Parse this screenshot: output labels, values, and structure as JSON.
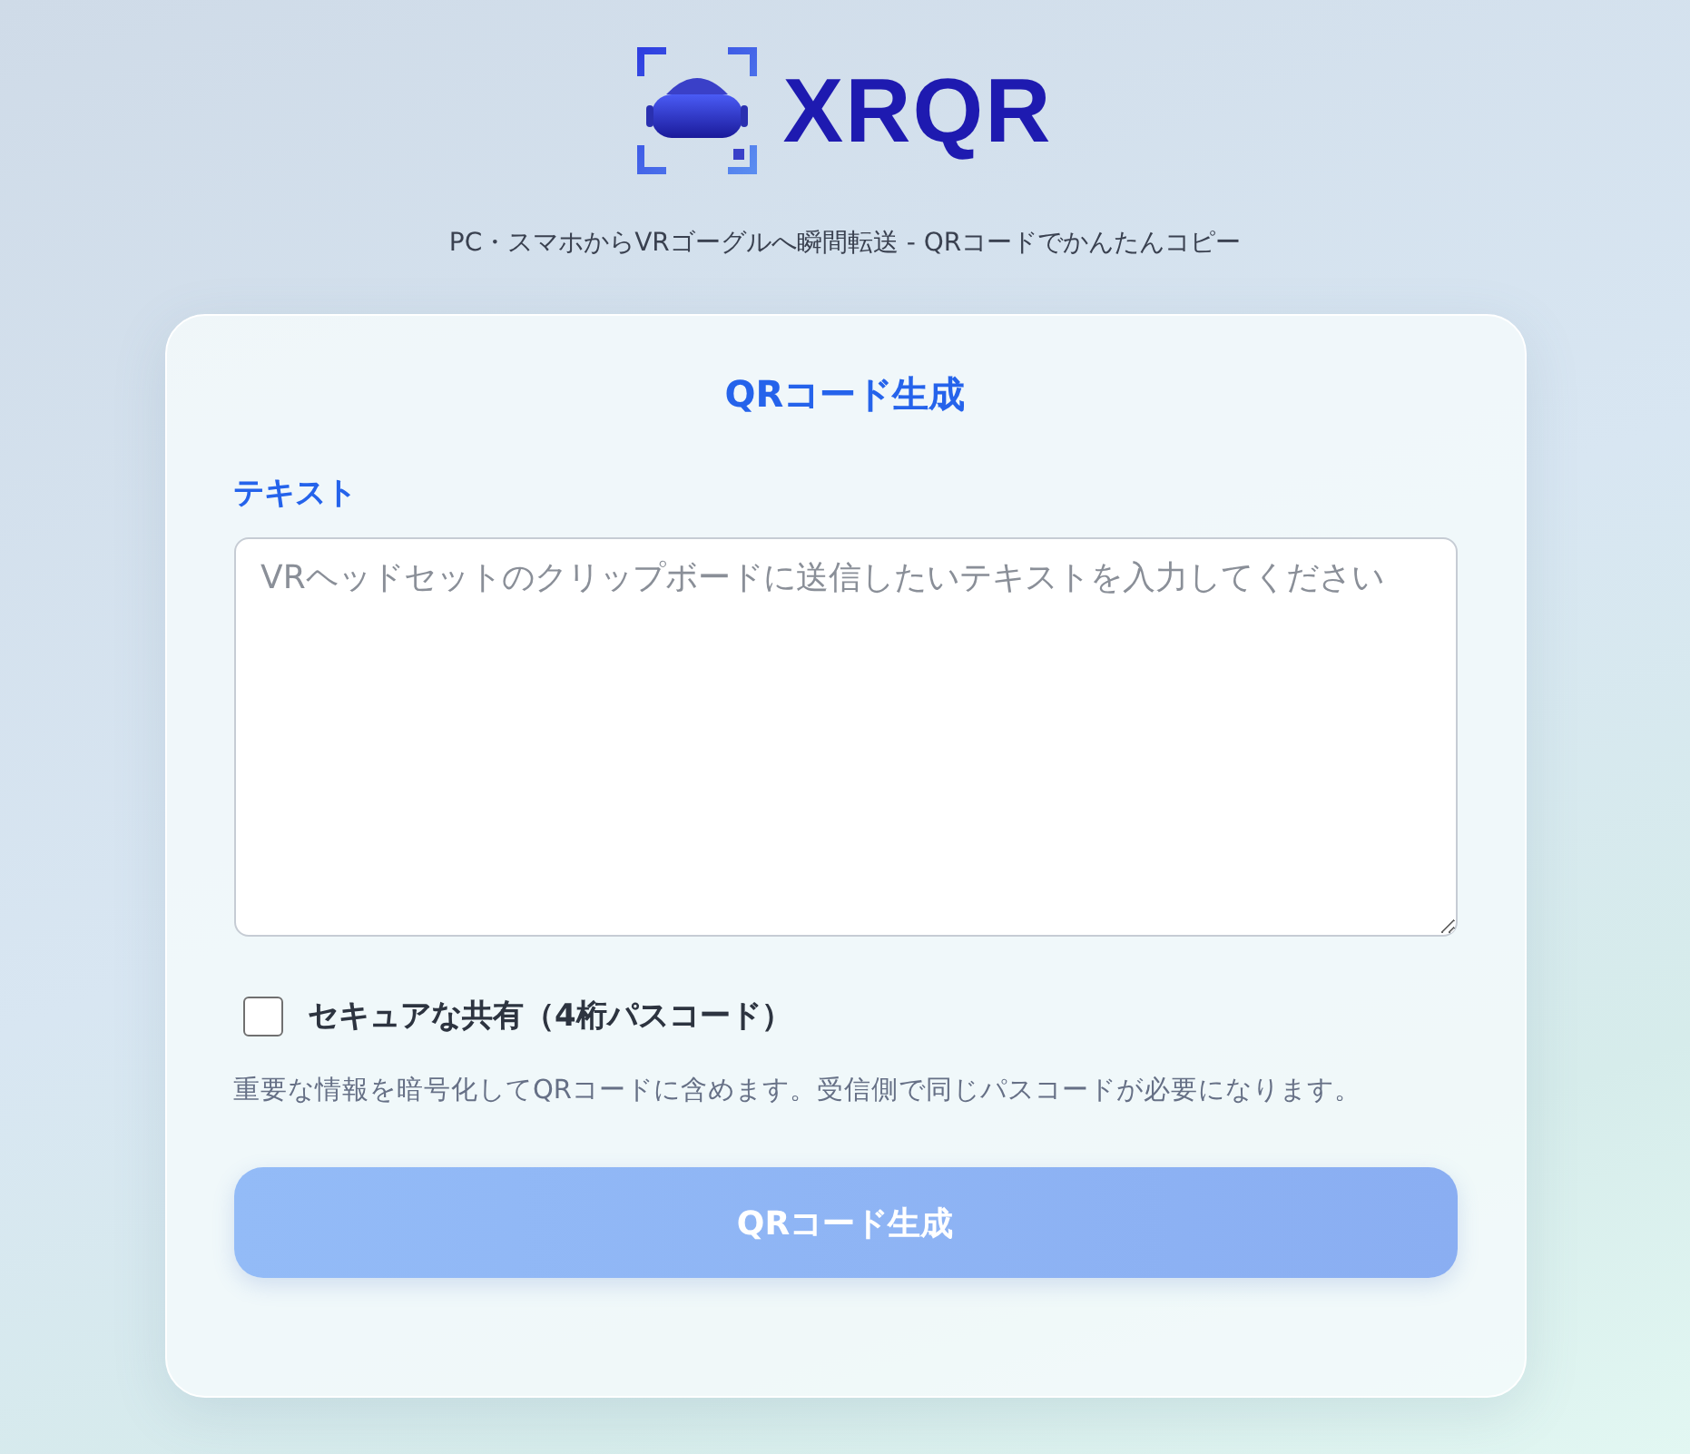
{
  "header": {
    "logo_text": "XRQR",
    "tagline": "PC・スマホからVRゴーグルへ瞬間転送 - QRコードでかんたんコピー"
  },
  "card": {
    "title": "QRコード生成",
    "text_label": "テキスト",
    "text_field": {
      "placeholder": "VRヘッドセットのクリップボードに送信したいテキストを入力してください"
    },
    "secure": {
      "label": "セキュアな共有（4桁パスコード）",
      "checked": false
    },
    "help": "重要な情報を暗号化してQRコードに含めます。受信側で同じパスコードが必要になります。",
    "submit": {
      "label": "QRコード生成",
      "disabled": true
    }
  }
}
